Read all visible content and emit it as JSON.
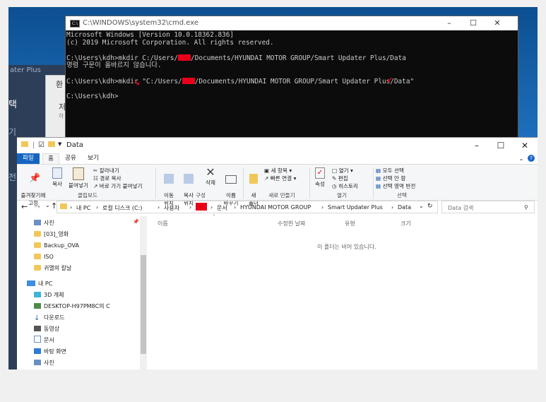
{
  "cmd": {
    "title": "C:\\WINDOWS\\system32\\cmd.exe",
    "lines": [
      "Microsoft Windows [Version 10.0.18362.836]",
      "(c) 2019 Microsoft Corporation. All rights reserved.",
      "",
      "C:\\Users\\kdh>mkdir C:/Users/",
      "명령 구문이 올바르지 않습니다.",
      "",
      "C:\\Users\\kdh>mkdir \"C:/Users/",
      "",
      "C:\\Users\\kdh>"
    ],
    "line4_rest": "/Documents/HYUNDAI MOTOR GROUP/Smart Updater Plus/Data",
    "line7_rest": "/Documents/HYUNDAI MOTOR GROUP/Smart Updater Plus/Data\""
  },
  "background_app": {
    "title_fragment": "ater Plus",
    "labels": [
      "택",
      "기",
      "전"
    ],
    "panel_labels": [
      "환",
      "저",
      "하"
    ]
  },
  "explorer": {
    "title": "Data",
    "tabs": [
      "파일",
      "홈",
      "공유",
      "보기"
    ],
    "ribbon": {
      "pin": "즐겨찾기에\n고정",
      "copy": "복사",
      "paste": "붙여넣기",
      "cut": "잘라내기",
      "copy_path": "경로 복사",
      "paste_shortcut": "바로 가기 붙여넣기",
      "group_clipboard": "클립보드",
      "move_to": "이동\n위치",
      "copy_to": "복사\n위치",
      "delete": "삭제",
      "rename": "이름\n바꾸기",
      "group_organize": "구성",
      "new_folder": "새\n폴더",
      "new_item": "새 항목",
      "easy_access": "빠른 연결",
      "group_new": "새로 만들기",
      "properties": "속성",
      "open": "열기",
      "edit": "편집",
      "history": "히스토리",
      "group_open": "열기",
      "select_all": "모두 선택",
      "select_none": "선택 안 함",
      "invert_selection": "선택 영역 반전",
      "group_select": "선택"
    },
    "breadcrumb": [
      "내 PC",
      "로컬 디스크 (C:)",
      "사용자",
      "",
      "문서",
      "HYUNDAI MOTOR GROUP",
      "Smart Updater Plus",
      "Data"
    ],
    "search_placeholder": "Data 검색",
    "nav_items": [
      "사진",
      "[03]_영화",
      "Backup_OVA",
      "ISO",
      "귀멸의 칼날",
      "내 PC",
      "3D 개체",
      "DESKTOP-H97PM8C의 C",
      "다운로드",
      "동영상",
      "문서",
      "바탕 화면",
      "사진"
    ],
    "columns": [
      "이름",
      "수정한 날짜",
      "유형",
      "크기"
    ],
    "empty_message": "이 폴더는 비어 있습니다."
  },
  "colors": {
    "accent": "#1565c0",
    "redact": "#e8001a",
    "cmd_bg": "#0c0c0c"
  }
}
